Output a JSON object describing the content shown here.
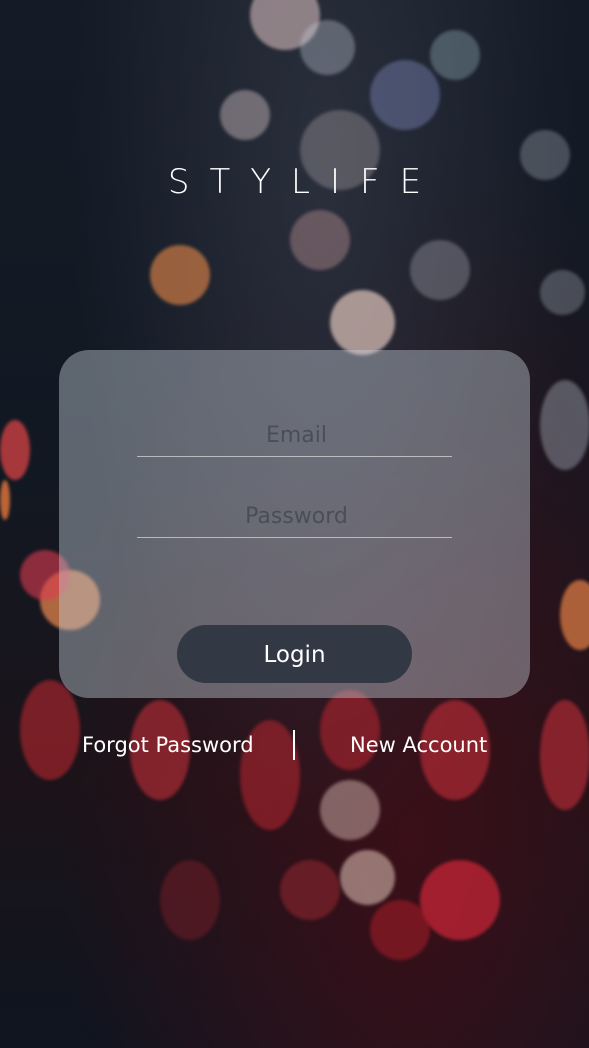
{
  "app": {
    "logo_text": "STYLIFE"
  },
  "login_form": {
    "email_placeholder": "Email",
    "password_placeholder": "Password",
    "login_label": "Login"
  },
  "footer_links": {
    "forgot_password_label": "Forgot Password",
    "new_account_label": "New Account"
  },
  "colors": {
    "card_background": "#C8D2DC",
    "login_button": "#262F3A",
    "text": "#FFFFFF"
  }
}
